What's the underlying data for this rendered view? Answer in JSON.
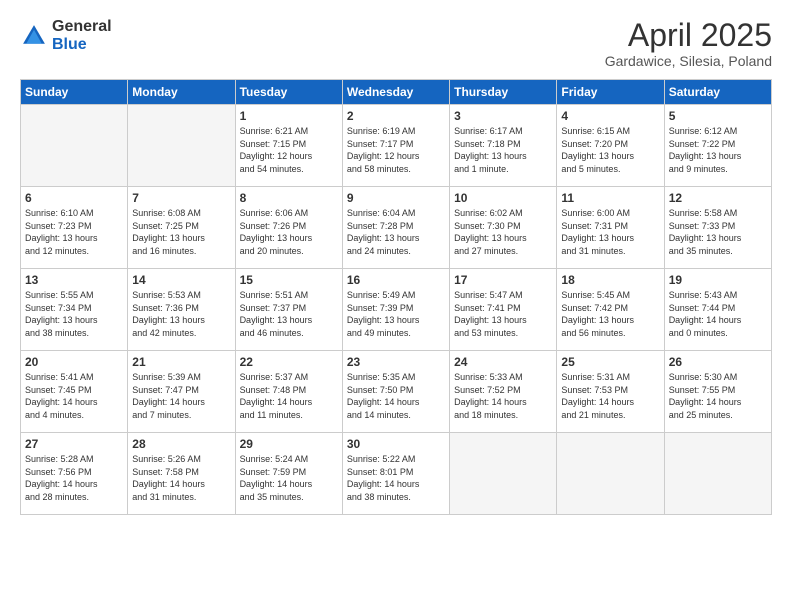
{
  "logo": {
    "general": "General",
    "blue": "Blue"
  },
  "header": {
    "title": "April 2025",
    "subtitle": "Gardawice, Silesia, Poland"
  },
  "weekdays": [
    "Sunday",
    "Monday",
    "Tuesday",
    "Wednesday",
    "Thursday",
    "Friday",
    "Saturday"
  ],
  "weeks": [
    [
      {
        "day": "",
        "info": ""
      },
      {
        "day": "",
        "info": ""
      },
      {
        "day": "1",
        "info": "Sunrise: 6:21 AM\nSunset: 7:15 PM\nDaylight: 12 hours\nand 54 minutes."
      },
      {
        "day": "2",
        "info": "Sunrise: 6:19 AM\nSunset: 7:17 PM\nDaylight: 12 hours\nand 58 minutes."
      },
      {
        "day": "3",
        "info": "Sunrise: 6:17 AM\nSunset: 7:18 PM\nDaylight: 13 hours\nand 1 minute."
      },
      {
        "day": "4",
        "info": "Sunrise: 6:15 AM\nSunset: 7:20 PM\nDaylight: 13 hours\nand 5 minutes."
      },
      {
        "day": "5",
        "info": "Sunrise: 6:12 AM\nSunset: 7:22 PM\nDaylight: 13 hours\nand 9 minutes."
      }
    ],
    [
      {
        "day": "6",
        "info": "Sunrise: 6:10 AM\nSunset: 7:23 PM\nDaylight: 13 hours\nand 12 minutes."
      },
      {
        "day": "7",
        "info": "Sunrise: 6:08 AM\nSunset: 7:25 PM\nDaylight: 13 hours\nand 16 minutes."
      },
      {
        "day": "8",
        "info": "Sunrise: 6:06 AM\nSunset: 7:26 PM\nDaylight: 13 hours\nand 20 minutes."
      },
      {
        "day": "9",
        "info": "Sunrise: 6:04 AM\nSunset: 7:28 PM\nDaylight: 13 hours\nand 24 minutes."
      },
      {
        "day": "10",
        "info": "Sunrise: 6:02 AM\nSunset: 7:30 PM\nDaylight: 13 hours\nand 27 minutes."
      },
      {
        "day": "11",
        "info": "Sunrise: 6:00 AM\nSunset: 7:31 PM\nDaylight: 13 hours\nand 31 minutes."
      },
      {
        "day": "12",
        "info": "Sunrise: 5:58 AM\nSunset: 7:33 PM\nDaylight: 13 hours\nand 35 minutes."
      }
    ],
    [
      {
        "day": "13",
        "info": "Sunrise: 5:55 AM\nSunset: 7:34 PM\nDaylight: 13 hours\nand 38 minutes."
      },
      {
        "day": "14",
        "info": "Sunrise: 5:53 AM\nSunset: 7:36 PM\nDaylight: 13 hours\nand 42 minutes."
      },
      {
        "day": "15",
        "info": "Sunrise: 5:51 AM\nSunset: 7:37 PM\nDaylight: 13 hours\nand 46 minutes."
      },
      {
        "day": "16",
        "info": "Sunrise: 5:49 AM\nSunset: 7:39 PM\nDaylight: 13 hours\nand 49 minutes."
      },
      {
        "day": "17",
        "info": "Sunrise: 5:47 AM\nSunset: 7:41 PM\nDaylight: 13 hours\nand 53 minutes."
      },
      {
        "day": "18",
        "info": "Sunrise: 5:45 AM\nSunset: 7:42 PM\nDaylight: 13 hours\nand 56 minutes."
      },
      {
        "day": "19",
        "info": "Sunrise: 5:43 AM\nSunset: 7:44 PM\nDaylight: 14 hours\nand 0 minutes."
      }
    ],
    [
      {
        "day": "20",
        "info": "Sunrise: 5:41 AM\nSunset: 7:45 PM\nDaylight: 14 hours\nand 4 minutes."
      },
      {
        "day": "21",
        "info": "Sunrise: 5:39 AM\nSunset: 7:47 PM\nDaylight: 14 hours\nand 7 minutes."
      },
      {
        "day": "22",
        "info": "Sunrise: 5:37 AM\nSunset: 7:48 PM\nDaylight: 14 hours\nand 11 minutes."
      },
      {
        "day": "23",
        "info": "Sunrise: 5:35 AM\nSunset: 7:50 PM\nDaylight: 14 hours\nand 14 minutes."
      },
      {
        "day": "24",
        "info": "Sunrise: 5:33 AM\nSunset: 7:52 PM\nDaylight: 14 hours\nand 18 minutes."
      },
      {
        "day": "25",
        "info": "Sunrise: 5:31 AM\nSunset: 7:53 PM\nDaylight: 14 hours\nand 21 minutes."
      },
      {
        "day": "26",
        "info": "Sunrise: 5:30 AM\nSunset: 7:55 PM\nDaylight: 14 hours\nand 25 minutes."
      }
    ],
    [
      {
        "day": "27",
        "info": "Sunrise: 5:28 AM\nSunset: 7:56 PM\nDaylight: 14 hours\nand 28 minutes."
      },
      {
        "day": "28",
        "info": "Sunrise: 5:26 AM\nSunset: 7:58 PM\nDaylight: 14 hours\nand 31 minutes."
      },
      {
        "day": "29",
        "info": "Sunrise: 5:24 AM\nSunset: 7:59 PM\nDaylight: 14 hours\nand 35 minutes."
      },
      {
        "day": "30",
        "info": "Sunrise: 5:22 AM\nSunset: 8:01 PM\nDaylight: 14 hours\nand 38 minutes."
      },
      {
        "day": "",
        "info": ""
      },
      {
        "day": "",
        "info": ""
      },
      {
        "day": "",
        "info": ""
      }
    ]
  ]
}
